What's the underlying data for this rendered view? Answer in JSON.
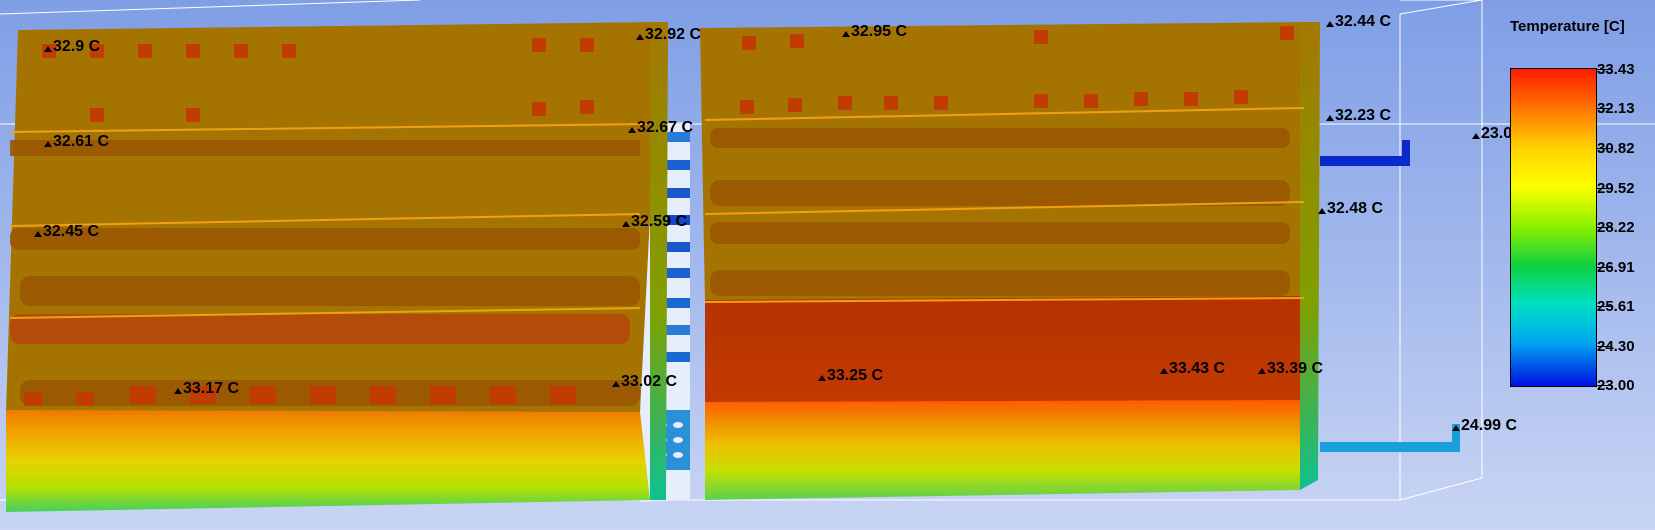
{
  "legend": {
    "title": "Temperature [C]",
    "ticks": [
      "33.43",
      "32.13",
      "30.82",
      "29.52",
      "28.22",
      "26.91",
      "25.61",
      "24.30",
      "23.00"
    ]
  },
  "probes": [
    {
      "label": "32.9 C"
    },
    {
      "label": "32.92 C"
    },
    {
      "label": "32.95 C"
    },
    {
      "label": "32.44 C"
    },
    {
      "label": "32.61 C"
    },
    {
      "label": "32.67 C"
    },
    {
      "label": "32.23 C"
    },
    {
      "label": "23.0"
    },
    {
      "label": "32.45 C"
    },
    {
      "label": "32.59 C"
    },
    {
      "label": "32.48 C"
    },
    {
      "label": "33.17 C"
    },
    {
      "label": "33.02 C"
    },
    {
      "label": "33.25 C"
    },
    {
      "label": "33.43 C"
    },
    {
      "label": "33.39 C"
    },
    {
      "label": "24.99 C"
    }
  ],
  "colors": {
    "hot": "#b03a00",
    "warm": "#a87500",
    "yellow": "#e0d000",
    "green": "#6fd030",
    "cold": "#0a2ad0",
    "cyan": "#1aa0d8"
  }
}
